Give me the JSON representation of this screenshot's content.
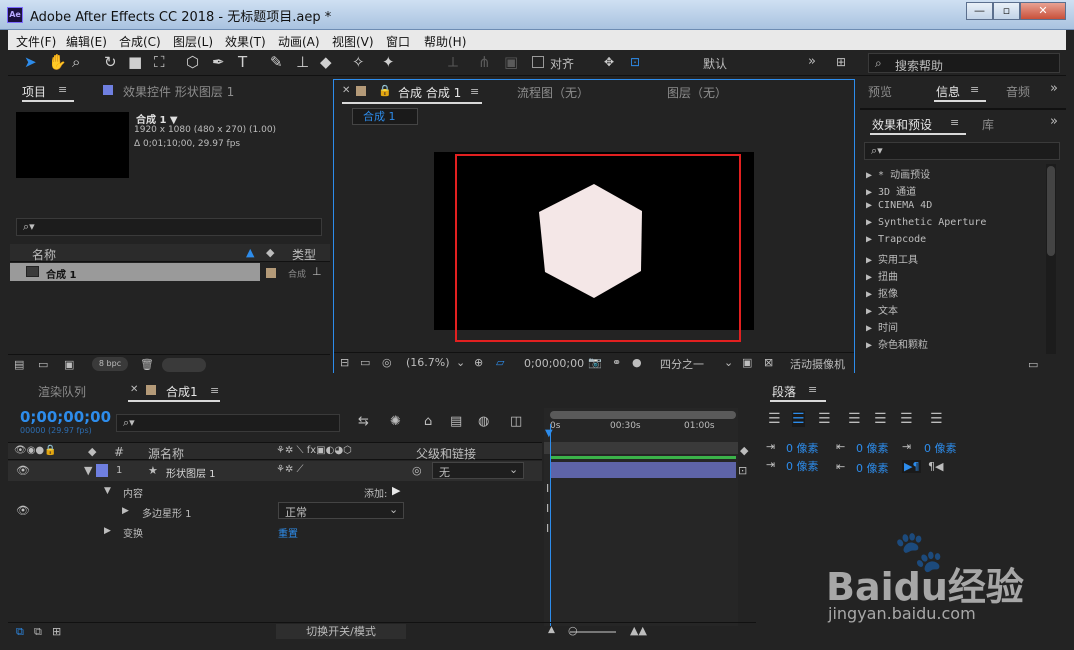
{
  "window": {
    "title": "Adobe After Effects CC 2018 - 无标题项目.aep *",
    "icon": "Ae",
    "min": "—",
    "max": "▫",
    "close": "✕"
  },
  "menu": [
    "文件(F)",
    "编辑(E)",
    "合成(C)",
    "图层(L)",
    "效果(T)",
    "动画(A)",
    "视图(V)",
    "窗口",
    "帮助(H)"
  ],
  "toolbar": {
    "snap_label": "对齐",
    "workspace": "默认",
    "search_placeholder": "搜索帮助"
  },
  "project": {
    "tab": "项目",
    "effect_controls_tab": "效果控件 形状图层 1",
    "comp_name": "合成 1 ▼",
    "comp_size": "1920 x 1080 (480 x 270) (1.00)",
    "comp_duration": "Δ 0;01;10;00, 29.97 fps",
    "col_name": "名称",
    "col_type": "类型",
    "item_name": "合成 1",
    "item_type": "合成",
    "bpc": "8 bpc"
  },
  "viewer": {
    "comp_tab": "合成 合成 1",
    "flow_tab": "流程图（无）",
    "layer_tab": "图层（无）",
    "breadcrumb": "合成 1",
    "zoom": "(16.7%)",
    "timecode": "0;00;00;00",
    "resolution": "四分之一",
    "camera": "活动摄像机"
  },
  "right": {
    "preview_tab": "预览",
    "info_tab": "信息",
    "audio_tab": "音频",
    "effects_tab": "效果和预设",
    "library_tab": "库",
    "search_placeholder": "",
    "effects": [
      "▶ * 动画预设",
      "▶ 3D 通道",
      "▶ CINEMA 4D",
      "▶ Synthetic Aperture",
      "▶ Trapcode",
      "▶ 实用工具",
      "▶ 扭曲",
      "▶ 抠像",
      "▶ 文本",
      "▶ 时间",
      "▶ 杂色和颗粒"
    ],
    "paragraph_tab": "段落",
    "indent_values": [
      "0 像素",
      "0 像素",
      "0 像素",
      "0 像素",
      "0 像素"
    ]
  },
  "timeline": {
    "render_tab": "渲染队列",
    "comp_tab": "合成1",
    "timecode": "0;00;00;00",
    "timecode_sub": "00000 (29.97 fps)",
    "col_num": "#",
    "col_source": "源名称",
    "col_parent": "父级和链接",
    "layer_num": "1",
    "layer_name": "形状图层 1",
    "parent_value": "无",
    "contents": "内容",
    "add": "添加:",
    "polygon": "多边星形 1",
    "blend_mode": "正常",
    "transform": "变换",
    "reset": "重置",
    "switch_mode": "切换开关/模式",
    "ruler": [
      "0s",
      "00:30s",
      "01:00s"
    ]
  },
  "watermark": {
    "brand": "Baidu经验",
    "url": "jingyan.baidu.com"
  }
}
